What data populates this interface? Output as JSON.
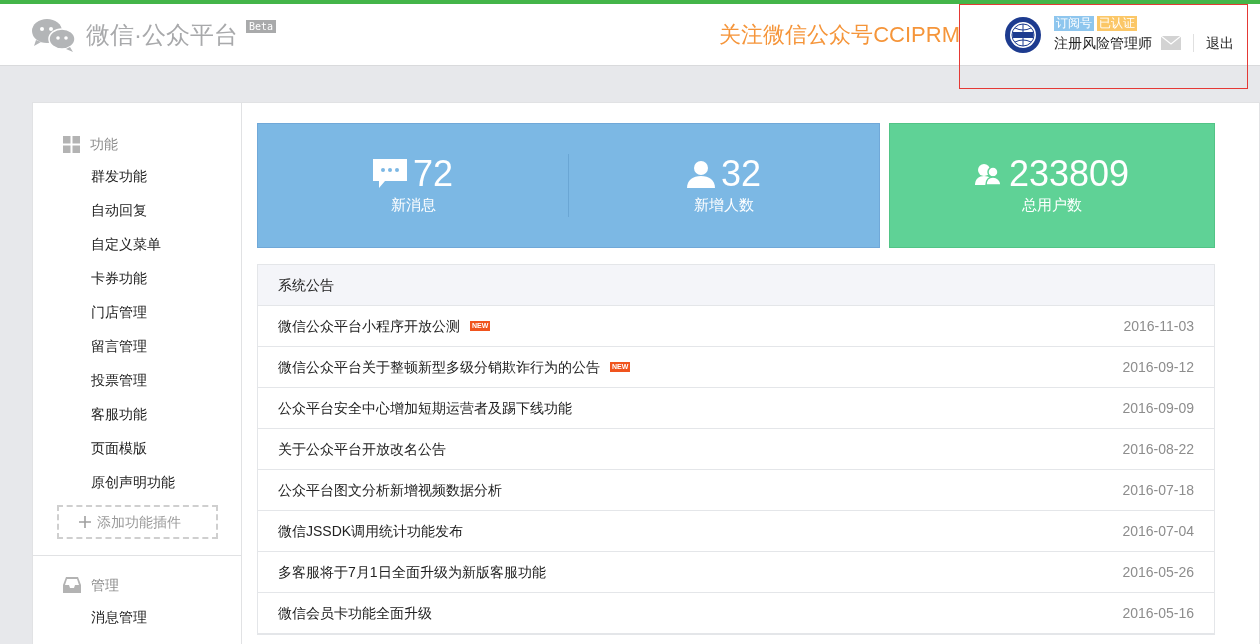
{
  "header": {
    "logo_text": "微信·公众平台",
    "beta": "Beta",
    "promo": "关注微信公众号CCIPRM",
    "account": {
      "type_tag": "订阅号",
      "verified_tag": "已认证",
      "name": "注册风险管理师",
      "logout": "退出"
    }
  },
  "sidebar": {
    "sections": [
      {
        "kind": "grid",
        "title": "功能",
        "items": [
          "群发功能",
          "自动回复",
          "自定义菜单",
          "卡券功能",
          "门店管理",
          "留言管理",
          "投票管理",
          "客服功能",
          "页面模版",
          "原创声明功能"
        ],
        "add_button": "添加功能插件"
      },
      {
        "kind": "tray",
        "title": "管理",
        "items": [
          "消息管理"
        ]
      }
    ]
  },
  "stats": [
    {
      "kind": "message",
      "value": "72",
      "label": "新消息"
    },
    {
      "kind": "person",
      "value": "32",
      "label": "新增人数"
    },
    {
      "kind": "people",
      "value": "233809",
      "label": "总用户数"
    }
  ],
  "notices": {
    "title": "系统公告",
    "rows": [
      {
        "title": "微信公众平台小程序开放公测",
        "badge": "NEW",
        "date": "2016-11-03"
      },
      {
        "title": "微信公众平台关于整顿新型多级分销欺诈行为的公告",
        "badge": "NEW",
        "date": "2016-09-12"
      },
      {
        "title": "公众平台安全中心增加短期运营者及踢下线功能",
        "date": "2016-09-09"
      },
      {
        "title": "关于公众平台开放改名公告",
        "date": "2016-08-22"
      },
      {
        "title": "公众平台图文分析新增视频数据分析",
        "date": "2016-07-18"
      },
      {
        "title": "微信JSSDK调用统计功能发布",
        "date": "2016-07-04"
      },
      {
        "title": "多客服将于7月1日全面升级为新版客服功能",
        "date": "2016-05-26"
      },
      {
        "title": "微信会员卡功能全面升级",
        "date": "2016-05-16"
      }
    ]
  }
}
